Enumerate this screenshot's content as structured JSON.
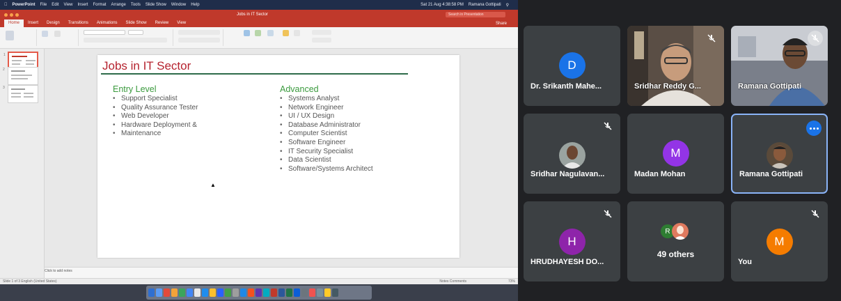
{
  "mac_menubar": {
    "app": "PowerPoint",
    "menus": [
      "File",
      "Edit",
      "View",
      "Insert",
      "Format",
      "Arrange",
      "Tools",
      "Slide Show",
      "Window",
      "Help"
    ],
    "clock": "Sat 21 Aug 4:38:58 PM",
    "user": "Ramana Gottipati"
  },
  "ppt": {
    "doc_title": "Jobs in IT Sector",
    "search_placeholder": "Search in Presentation",
    "tabs": [
      "Home",
      "Insert",
      "Design",
      "Transitions",
      "Animations",
      "Slide Show",
      "Review",
      "View"
    ],
    "share_label": "Share",
    "notes_placeholder": "Click to add notes",
    "status_left": "Slide 1 of 3   English (United States)",
    "status_right": "Notes   Comments",
    "zoom": "73%"
  },
  "slide": {
    "title": "Jobs in IT Sector",
    "left_heading": "Entry Level",
    "left_items": [
      "Support Specialist",
      "Quality Assurance Tester",
      "Web Developer",
      "Hardware Deployment &",
      "Maintenance"
    ],
    "right_heading": "Advanced",
    "right_items": [
      "Systems Analyst",
      "Network Engineer",
      "UI / UX Design",
      "Database Administrator",
      "Computer Scientist",
      "Software Engineer",
      "IT Security Specialist",
      "Data Scientist",
      "Software/Systems Architect"
    ]
  },
  "participants": [
    {
      "name": "Dr. Srikanth Mahe...",
      "initial": "D",
      "color": "#1a73e8",
      "muted": false,
      "video": false
    },
    {
      "name": "Sridhar Reddy G...",
      "initial": "",
      "color": "",
      "muted": true,
      "video": true
    },
    {
      "name": "Ramana Gottipati",
      "initial": "",
      "color": "",
      "muted": true,
      "video": true
    },
    {
      "name": "Sridhar Nagulavan...",
      "initial": "",
      "color": "",
      "muted": true,
      "video": false,
      "photo": true
    },
    {
      "name": "Madan Mohan",
      "initial": "M",
      "color": "#9334e6",
      "muted": false,
      "video": false
    },
    {
      "name": "Ramana Gottipati",
      "initial": "",
      "color": "",
      "muted": false,
      "video": false,
      "photo": true,
      "highlighted": true
    },
    {
      "name": "HRUDHAYESH DO...",
      "initial": "H",
      "color": "#8e24aa",
      "muted": true,
      "video": false
    },
    {
      "name": "49 others",
      "initial": "R",
      "color": "#2e7d32",
      "muted": false,
      "video": false
    },
    {
      "name": "You",
      "initial": "M",
      "color": "#f57c00",
      "muted": true,
      "video": false
    }
  ]
}
